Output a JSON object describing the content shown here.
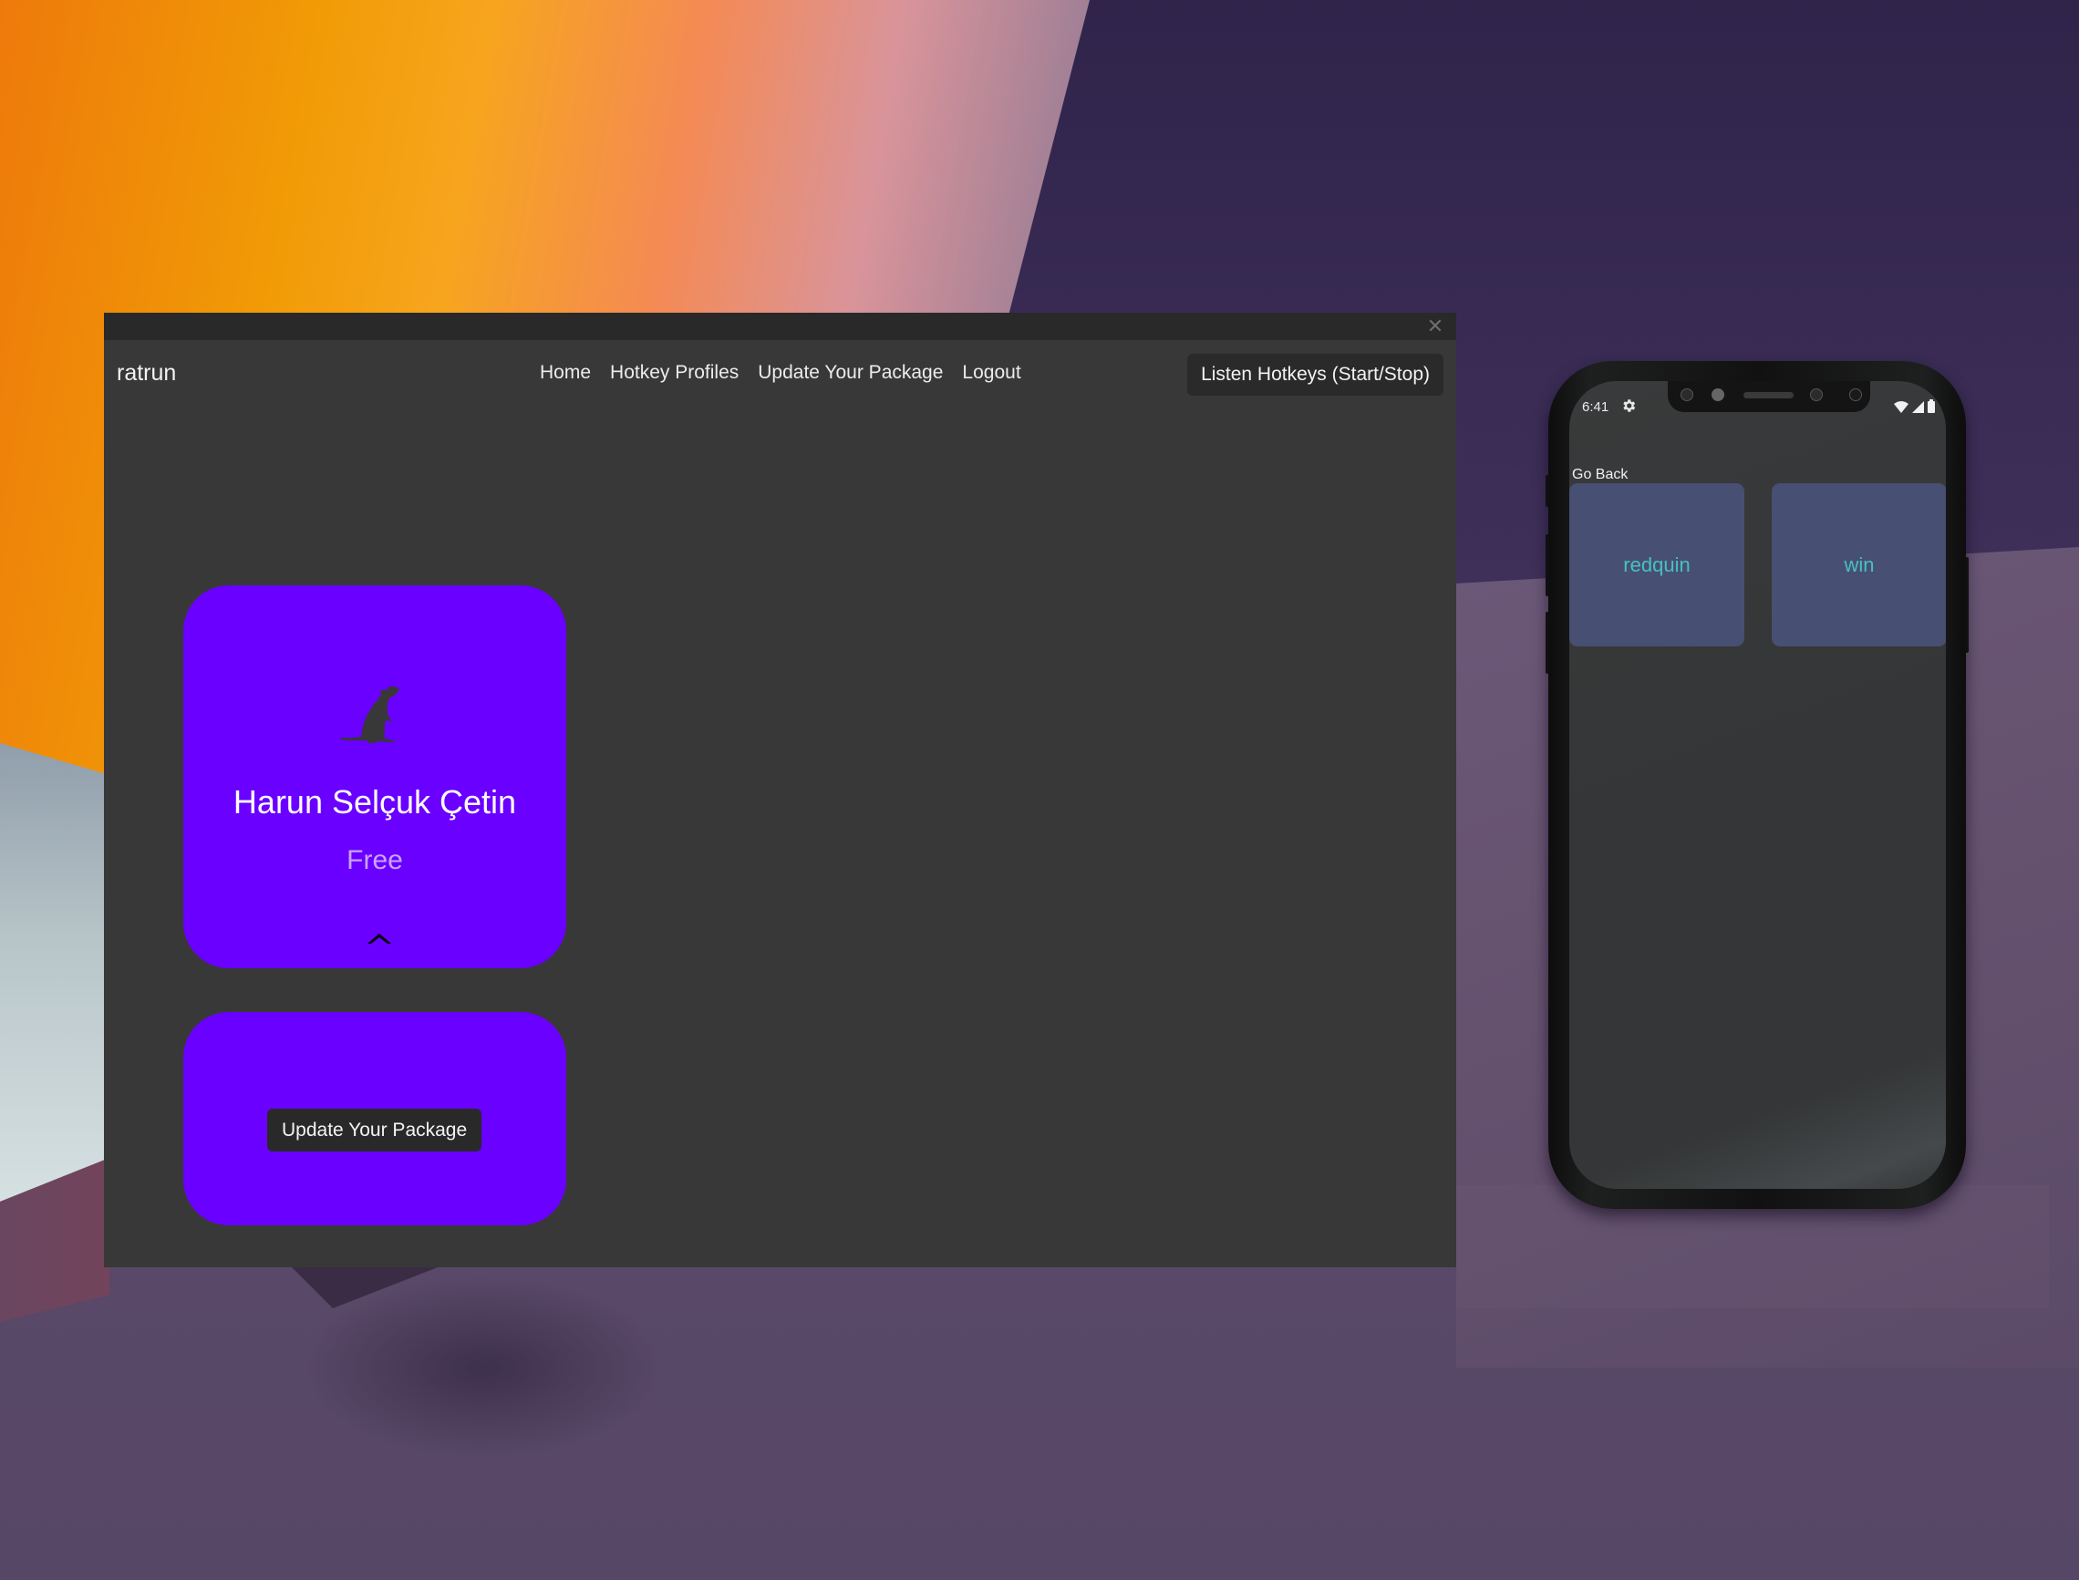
{
  "desktop_window": {
    "close_icon": "close-icon",
    "brand": "ratrun",
    "nav": [
      {
        "label": "Home"
      },
      {
        "label": "Hotkey Profiles"
      },
      {
        "label": "Update Your Package"
      },
      {
        "label": "Logout"
      }
    ],
    "listen_button": "Listen Hotkeys (Start/Stop)",
    "profile_card": {
      "icon": "rat-icon",
      "name": "Harun Selçuk Çetin",
      "plan": "Free",
      "collapse_icon": "chevron-up-icon"
    },
    "package_card": {
      "button_label": "Update Your Package"
    }
  },
  "phone": {
    "status_bar": {
      "time": "6:41",
      "icons": [
        "gear-icon",
        "wifi-icon",
        "signal-icon",
        "battery-icon"
      ]
    },
    "go_back": "Go Back",
    "profiles": [
      {
        "label": "redquin"
      },
      {
        "label": "win"
      }
    ]
  },
  "colors": {
    "window_bg": "#383838",
    "titlebar_bg": "#292929",
    "card_accent": "#6a00ff",
    "plan_text": "#c7a4ff",
    "tile_bg": "#474f72",
    "tile_text": "#47c0c4"
  }
}
